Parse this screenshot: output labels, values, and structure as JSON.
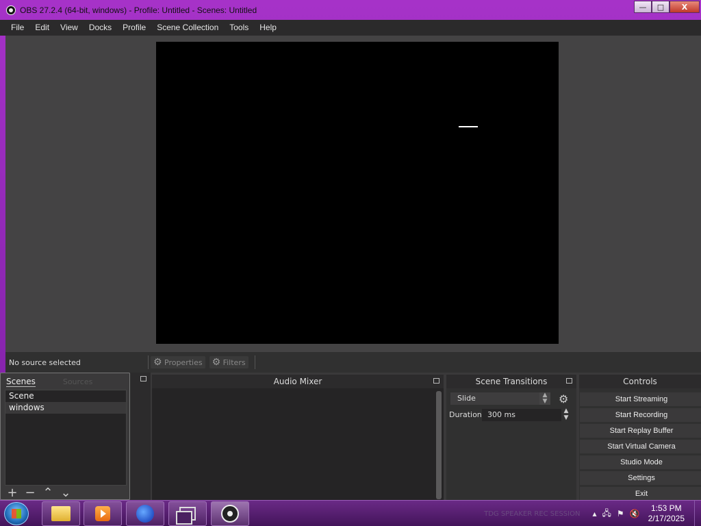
{
  "window": {
    "title": "OBS 27.2.4 (64-bit, windows) - Profile: Untitled - Scenes: Untitled",
    "controls": {
      "minimize": "—",
      "maximize": "□",
      "close": "X"
    }
  },
  "menu": [
    "File",
    "Edit",
    "View",
    "Docks",
    "Profile",
    "Scene Collection",
    "Tools",
    "Help"
  ],
  "source_bar": {
    "status": "No source selected",
    "properties_label": "Properties",
    "filters_label": "Filters"
  },
  "scenes": {
    "tab_label": "Scenes",
    "ghost_tab": "Sources",
    "items": [
      "Scene",
      "windows"
    ],
    "tools": {
      "add": "+",
      "remove": "−",
      "up": "⌃",
      "down": "⌄"
    }
  },
  "audio_mixer": {
    "title": "Audio Mixer"
  },
  "scene_transitions": {
    "title": "Scene Transitions",
    "transition": "Slide",
    "duration_label": "Duration",
    "duration_value": "300 ms"
  },
  "controls": {
    "title": "Controls",
    "buttons": [
      "Start Streaming",
      "Start Recording",
      "Start Replay Buffer",
      "Start Virtual Camera",
      "Studio Mode",
      "Settings",
      "Exit"
    ]
  },
  "taskbar": {
    "apps": [
      "explorer-icon",
      "media-player-icon",
      "firefox-icon",
      "task-view-icon",
      "obs-icon"
    ],
    "tray_ghost": "TDG SPEAKER   REC SESSION",
    "time": "1:53 PM",
    "date": "2/17/2025"
  },
  "colors": {
    "window_frame": "#a632c8",
    "panel_bg": "#3a393a",
    "preview_bg": "#000000",
    "taskbar": "#6a2a86"
  }
}
